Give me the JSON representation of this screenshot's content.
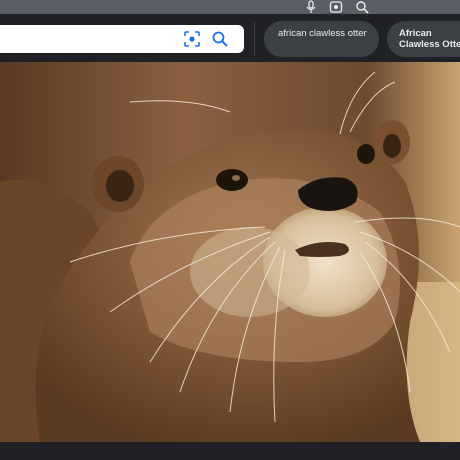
{
  "search": {
    "value": "",
    "lens_icon": "lens-icon",
    "search_icon": "search-icon"
  },
  "top_icons": [
    "mic-icon",
    "camera-search-icon",
    "search-icon"
  ],
  "chips": [
    {
      "label": "african clawless otter"
    },
    {
      "label": "African Clawless Otter"
    }
  ],
  "image": {
    "subject": "otter photo"
  },
  "colors": {
    "background": "#202124",
    "chip": "#3c4043",
    "search_box": "#ffffff"
  }
}
